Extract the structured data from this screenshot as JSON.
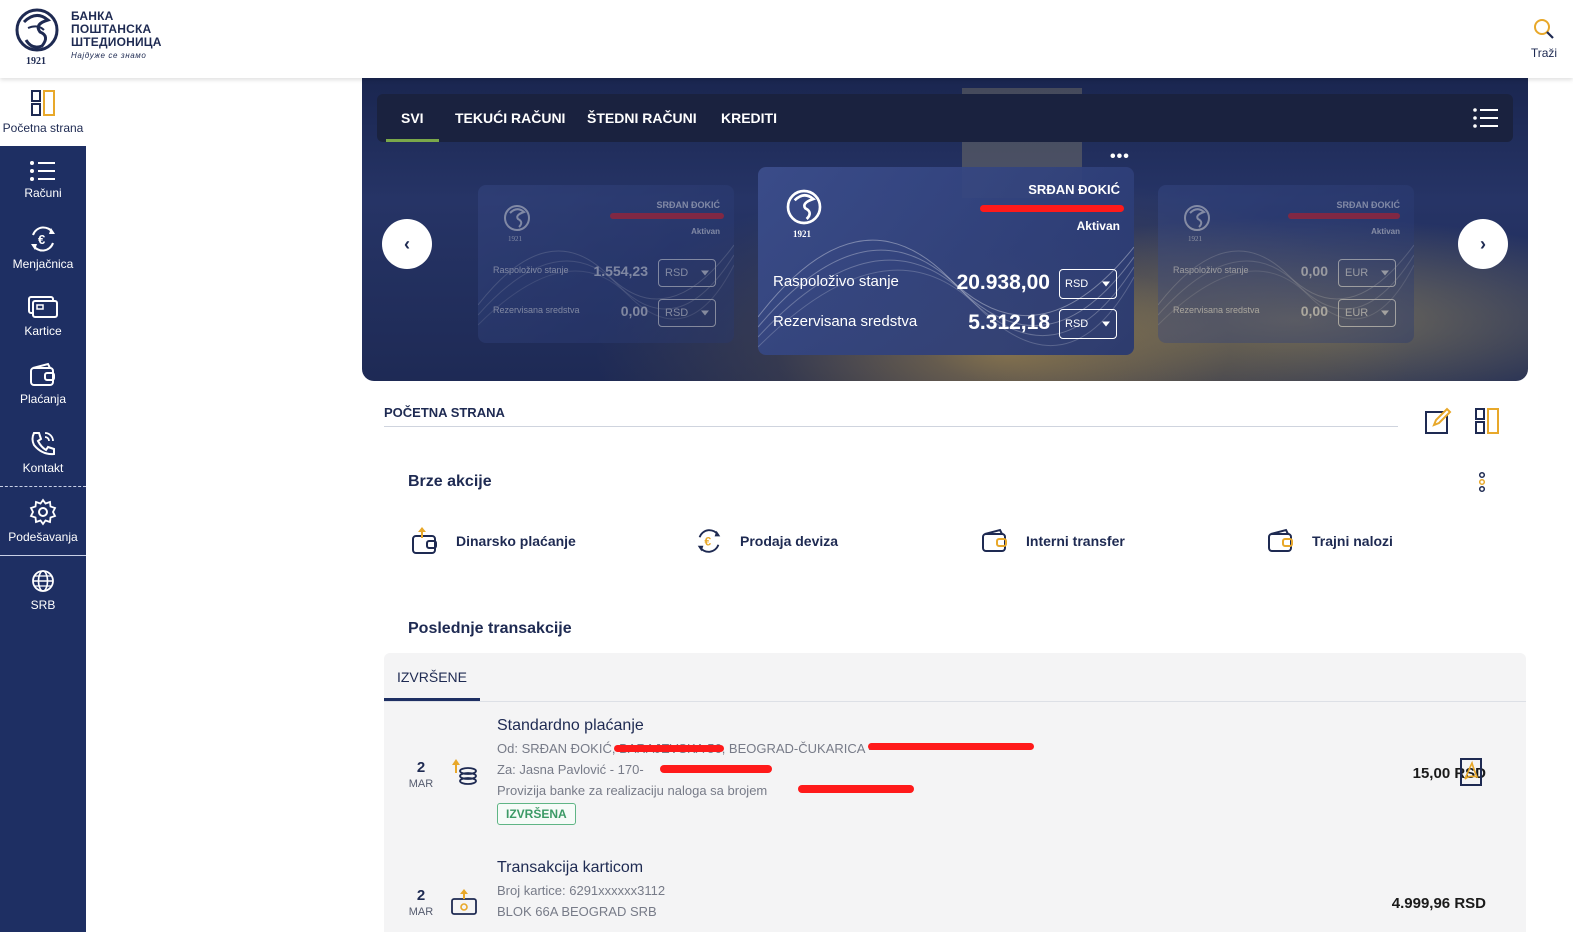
{
  "header": {
    "logo_year": "1921",
    "logo_lines": [
      "БАНКА",
      "ПОШТАНСКА",
      "ШТЕДИОНИЦА"
    ],
    "logo_slogan": "Најдуже се знамо",
    "search_label": "Traži",
    "search_icon": "search-icon"
  },
  "sidebar": {
    "items": [
      {
        "label": "Početna strana",
        "icon": "dashboard-icon"
      },
      {
        "label": "Računi",
        "icon": "list-icon"
      },
      {
        "label": "Menjačnica",
        "icon": "currency-exchange-icon"
      },
      {
        "label": "Kartice",
        "icon": "cards-icon"
      },
      {
        "label": "Plaćanja",
        "icon": "wallet-icon"
      },
      {
        "label": "Kontakt",
        "icon": "phone-icon"
      },
      {
        "label": "Podešavanja",
        "icon": "gear-icon"
      },
      {
        "label": "SRB",
        "icon": "globe-icon"
      }
    ]
  },
  "hero": {
    "tabs": [
      "SVI",
      "TEKUĆI RAČUNI",
      "ŠTEDNI RAČUNI",
      "KREDITI"
    ],
    "active_tab": "SVI",
    "more_dots": "•••",
    "cards": [
      {
        "name": "SRĐAN ĐOKIĆ",
        "status": "Aktivan",
        "available_label": "Raspoloživo stanje",
        "available": "1.554,23",
        "available_currency": "RSD",
        "reserved_label": "Rezervisana sredstva",
        "reserved": "0,00",
        "reserved_currency": "RSD",
        "year": "1921"
      },
      {
        "name": "SRĐAN ĐOKIĆ",
        "status": "Aktivan",
        "available_label": "Raspoloživo stanje",
        "available": "20.938,00",
        "available_currency": "RSD",
        "reserved_label": "Rezervisana sredstva",
        "reserved": "5.312,18",
        "reserved_currency": "RSD",
        "year": "1921"
      },
      {
        "name": "SRĐAN ĐOKIĆ",
        "status": "Aktivan",
        "available_label": "Raspoloživo stanje",
        "available": "0,00",
        "available_currency": "EUR",
        "reserved_label": "Rezervisana sredstva",
        "reserved": "0,00",
        "reserved_currency": "EUR",
        "year": "1921"
      }
    ]
  },
  "page": {
    "title": "POČETNA STRANA",
    "quick_actions_title": "Brze akcije",
    "quick_actions": [
      {
        "label": "Dinarsko plaćanje",
        "icon": "payment-icon"
      },
      {
        "label": "Prodaja deviza",
        "icon": "currency-exchange-icon"
      },
      {
        "label": "Interni transfer",
        "icon": "transfer-icon"
      },
      {
        "label": "Trajni nalozi",
        "icon": "standing-order-icon"
      }
    ],
    "transactions_title": "Poslednje transakcije",
    "transactions_tab": "IZVRŠENE",
    "transactions": [
      {
        "day": "2",
        "month": "MAR",
        "title": "Standardno plaćanje",
        "lines": [
          "Od: SRĐAN ĐOKIĆ, BARAJEVSKA 56, BEOGRAD-ČUKARICA -",
          "Za: Jasna Pavlović - 170-",
          "Provizija banke za realizaciju naloga sa brojem"
        ],
        "status": "IZVRŠENA",
        "amount": "15,00 RSD"
      },
      {
        "day": "2",
        "month": "MAR",
        "title": "Transakcija karticom",
        "lines": [
          "Broj kartice: 6291xxxxxx3112",
          "BLOK 66A BEOGRAD SRB"
        ],
        "amount": "4.999,96 RSD"
      }
    ]
  },
  "colors": {
    "sidebar_bg": "#1e2f63",
    "accent_gold": "#e8a82a",
    "active_tab": "#7aa84a",
    "redaction": "#ff1a1a"
  }
}
